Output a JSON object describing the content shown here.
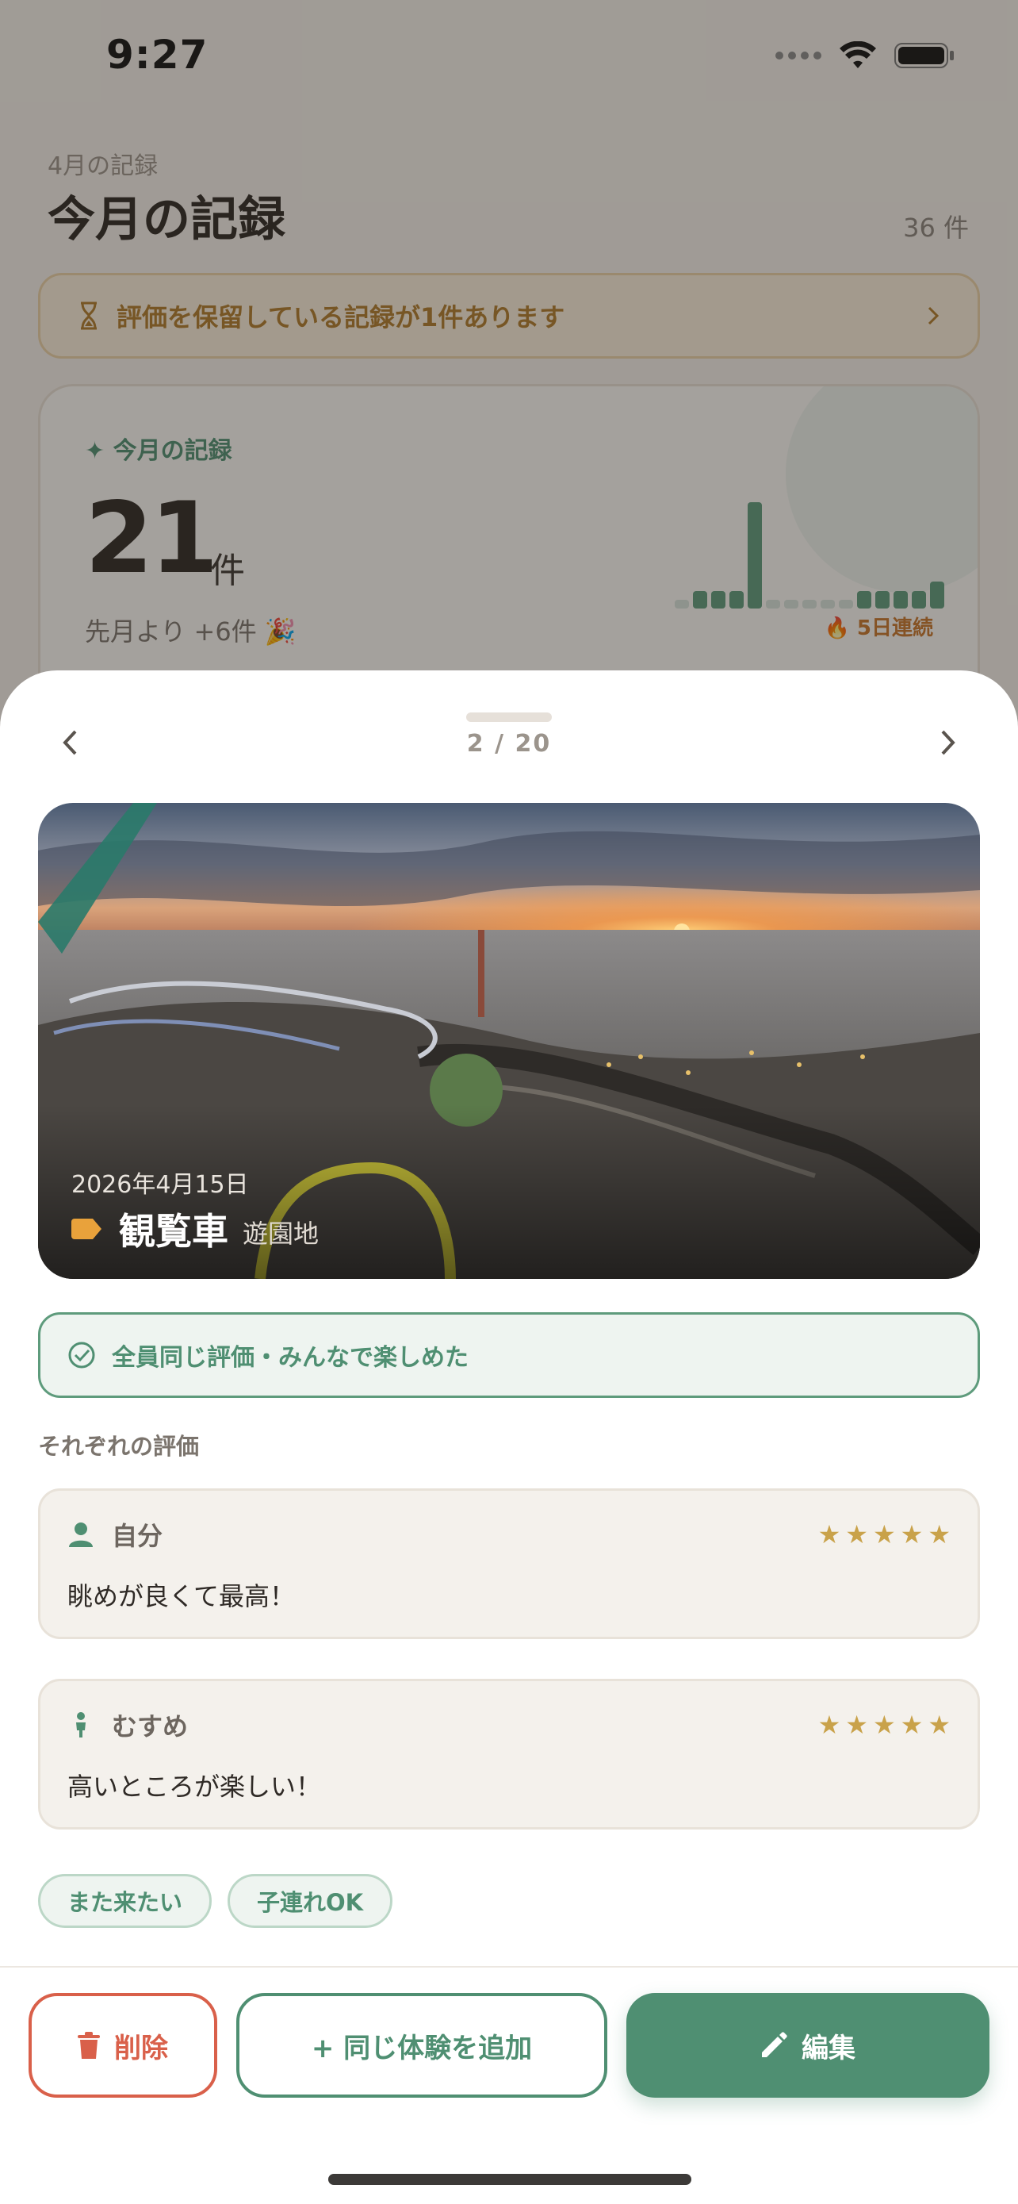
{
  "status_bar": {
    "time": "9:27"
  },
  "background": {
    "month_subtitle": "4月の記録",
    "title": "今月の記録",
    "count": "36 件",
    "pending_banner": "評価を保留している記録が1件あります",
    "stats": {
      "label": "今月の記録",
      "number": "21",
      "unit": "件",
      "diff": "先月より +6件 🎉",
      "streak": "5日連続",
      "daily_counts": [
        1,
        2,
        2,
        2,
        12,
        1,
        1,
        1,
        1,
        1,
        2,
        2,
        2,
        2,
        3
      ]
    }
  },
  "sheet": {
    "pager": "2 / 20",
    "record": {
      "date": "2026年4月15日",
      "title": "観覧車",
      "category": "遊園地"
    },
    "agreement": "全員同じ評価・みんなで楽しめた",
    "section_title": "それぞれの評価",
    "reviews": [
      {
        "name": "自分",
        "icon": "person-icon",
        "stars": 5,
        "comment": "眺めが良くて最高！"
      },
      {
        "name": "むすめ",
        "icon": "child-icon",
        "stars": 5,
        "comment": "高いところが楽しい！"
      }
    ],
    "tags": [
      "また来たい",
      "子連れOK"
    ],
    "actions": {
      "delete": "削除",
      "add_same": "+ 同じ体験を追加",
      "edit": "編集"
    }
  },
  "colors": {
    "accent_green": "#4f8f72",
    "delete_red": "#d9604a",
    "star_gold": "#c9a24a",
    "pending_amber": "#b07a2a"
  }
}
